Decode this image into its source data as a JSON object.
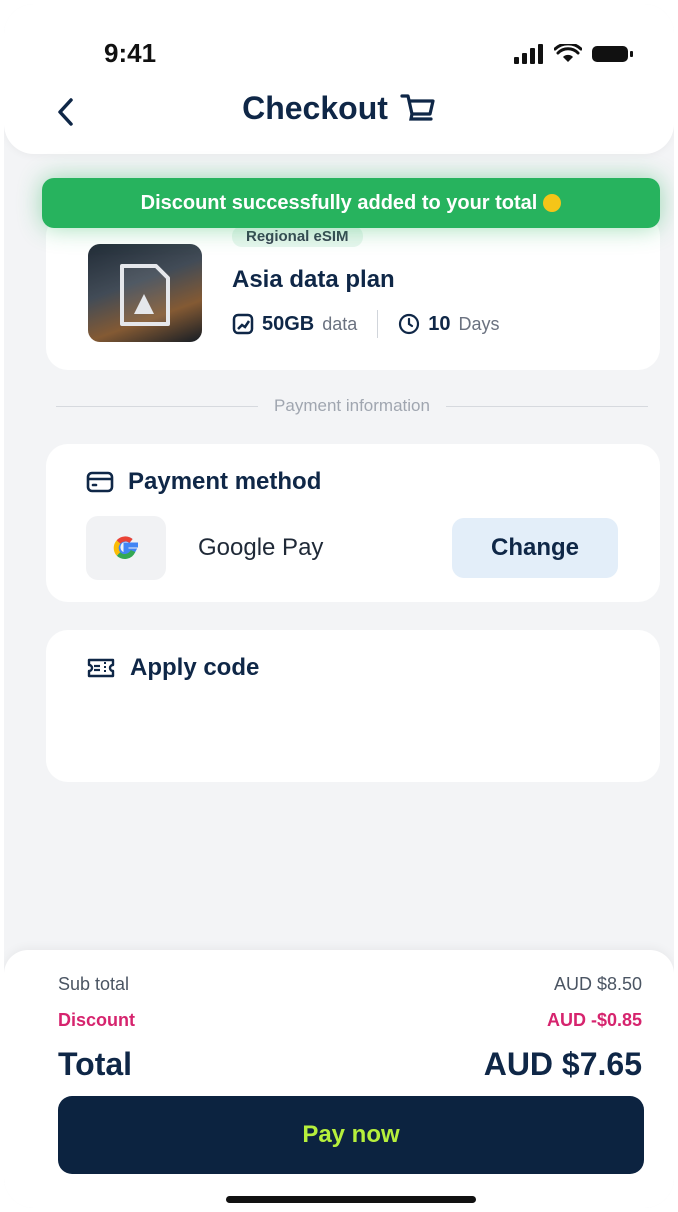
{
  "status_bar": {
    "time": "9:41"
  },
  "header": {
    "title": "Checkout",
    "back_icon": "chevron-left-icon",
    "cart_icon": "cart-icon"
  },
  "toast": {
    "message": "Discount successfully added to your total"
  },
  "plan": {
    "badge": "Regional eSIM",
    "name": "Asia data plan",
    "data_amount": "50GB",
    "data_unit": "data",
    "days_amount": "10",
    "days_unit": "Days"
  },
  "section_divider": {
    "label": "Payment information"
  },
  "payment": {
    "heading": "Payment method",
    "method_name": "Google Pay",
    "change_label": "Change"
  },
  "apply_code": {
    "heading": "Apply code"
  },
  "summary": {
    "subtotal_label": "Sub total",
    "subtotal_value": "AUD $8.50",
    "discount_label": "Discount",
    "discount_value": "AUD -$0.85",
    "total_label": "Total",
    "total_value": "AUD $7.65"
  },
  "pay_button": {
    "label": "Pay now"
  },
  "colors": {
    "navy": "#0f2747",
    "toast_green": "#27b35e",
    "discount_pink": "#d6246e",
    "pay_button_bg": "#0c2340",
    "pay_button_text": "#b6ef3c"
  }
}
